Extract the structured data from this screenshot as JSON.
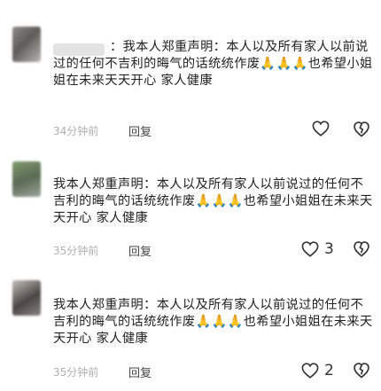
{
  "comments": [
    {
      "prefix": "：",
      "text": "我本人郑重声明：本人以及所有家人以前说过的任何不吉利的晦气的话统统作废",
      "hands": "🙏🙏🙏",
      "text2": "也希望小姐姐在未来天天开心  家人健康",
      "time": "34分钟前",
      "reply_label": "回复",
      "likes": ""
    },
    {
      "text": "我本人郑重声明：本人以及所有家人以前说过的任何不吉利的晦气的话统统作废",
      "hands": "🙏🙏🙏",
      "text2": "也希望小姐姐在未来天天开心  家人健康",
      "time": "35分钟前",
      "reply_label": "回复",
      "likes": "3"
    },
    {
      "text": "我本人郑重声明：本人以及所有家人以前说过的任何不吉利的晦气的话统统作废",
      "hands": "🙏🙏🙏",
      "text2": "也希望小姐姐在未来天天开心  家人健康",
      "time": "35分钟前",
      "reply_label": "回复",
      "likes": "2"
    }
  ]
}
